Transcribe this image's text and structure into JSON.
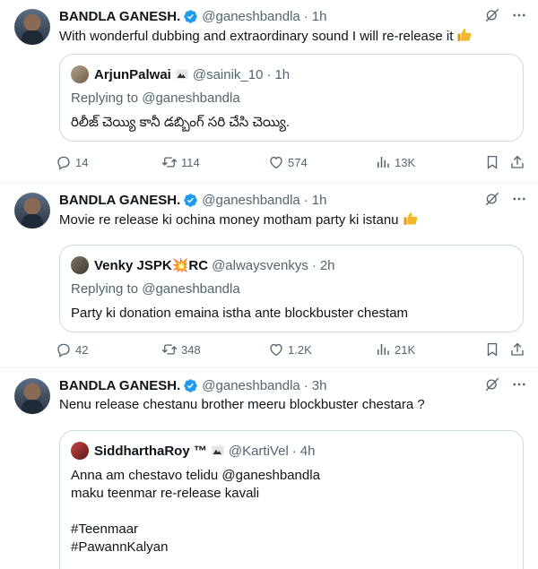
{
  "tweets": [
    {
      "author": "BANDLA GANESH.",
      "handle": "@ganeshbandla",
      "time": "1h",
      "text": "With wonderful dubbing and extraordinary sound I will re-release it",
      "quote": {
        "author": "ArjunPalwai",
        "handle": "@sainik_10",
        "time": "1h",
        "replying_label": "Replying to",
        "replying_to": "@ganeshbandla",
        "text": "రిలీజ్ చెయ్యి కానీ డబ్బింగ్ సరి చేసి చెయ్యి."
      },
      "stats": {
        "replies": "14",
        "retweets": "114",
        "likes": "574",
        "views": "13K"
      }
    },
    {
      "author": "BANDLA GANESH.",
      "handle": "@ganeshbandla",
      "time": "1h",
      "text": "Movie re release ki ochina money motham party ki istanu",
      "quote": {
        "author": "Venky JSPK💥RC",
        "handle": "@alwaysvenkys",
        "time": "2h",
        "replying_label": "Replying to",
        "replying_to": "@ganeshbandla",
        "text": "Party ki donation emaina istha ante blockbuster chestam"
      },
      "stats": {
        "replies": "42",
        "retweets": "348",
        "likes": "1.2K",
        "views": "21K"
      }
    },
    {
      "author": "BANDLA GANESH.",
      "handle": "@ganeshbandla",
      "time": "3h",
      "text": "Nenu release chestanu brother meeru blockbuster chestara ?",
      "quote": {
        "author": "SiddharthaRoy ™",
        "handle": "@KartiVel",
        "time": "4h",
        "text": "Anna am chestavo telidu @ganeshbandla\nmaku teenmar re-release kavali\n\n#Teenmaar\n#PawannKalyan"
      }
    }
  ],
  "colors": {
    "text": "#0f1419",
    "muted": "#536471",
    "verified": "#1d9bf0",
    "border": "#cfd9de"
  },
  "icons": [
    "verified-badge-icon",
    "grok-icon",
    "more-icon",
    "reply-icon",
    "retweet-icon",
    "like-icon",
    "views-icon",
    "bookmark-icon",
    "share-icon",
    "thumbs-up-emoji"
  ]
}
